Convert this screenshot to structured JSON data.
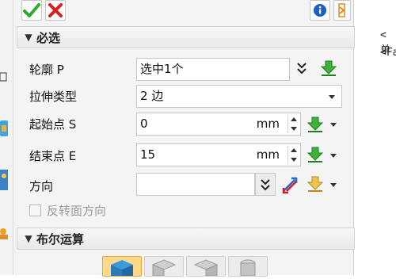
{
  "toolbar": {
    "ok_icon": "green-checkmark-icon",
    "cancel_icon": "red-x-icon",
    "info_icon": "info-icon",
    "help_icon": "help-icon"
  },
  "sections": {
    "required": "必选",
    "boolean": "布尔运算"
  },
  "fields": {
    "profile": {
      "label": "轮廓 P",
      "value": "选中1个"
    },
    "extrude_type": {
      "label": "拉伸类型",
      "value": "2 边"
    },
    "start_point": {
      "label": "起始点 S",
      "value": "0",
      "unit": "mm"
    },
    "end_point": {
      "label": "结束点 E",
      "value": "15",
      "unit": "mm"
    },
    "direction": {
      "label": "方向",
      "value": ""
    }
  },
  "reverse_direction": {
    "label": "反转面方向",
    "checked": false
  },
  "right_side": {
    "line1": "<单",
    "line2": "<Fa"
  },
  "colors": {
    "accent_green": "#2eaa2e",
    "red": "#d42020",
    "header_bg": "#eaeaea"
  }
}
